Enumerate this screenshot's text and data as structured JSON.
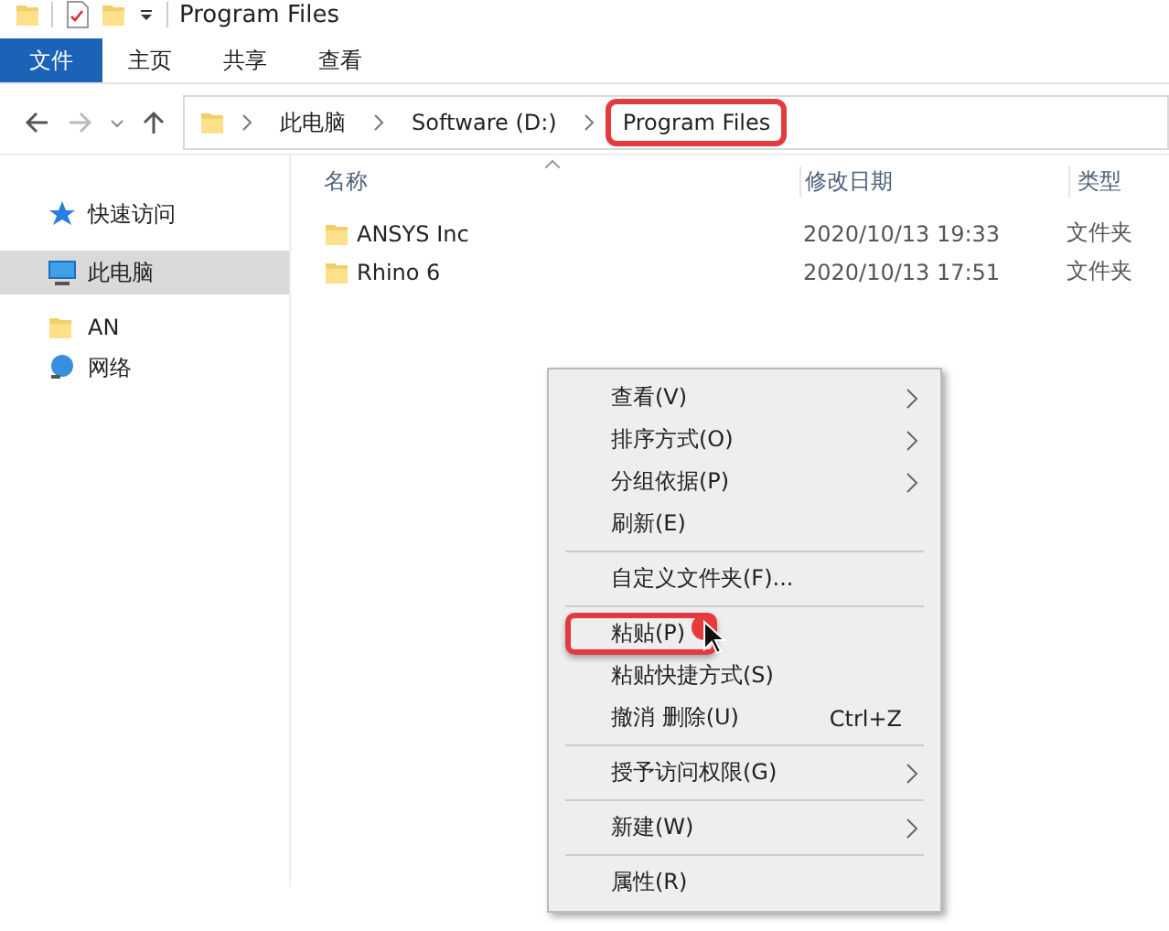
{
  "window": {
    "title": "Program Files"
  },
  "ribbon_tabs": [
    {
      "label": "文件",
      "selected": true
    },
    {
      "label": "主页",
      "selected": false
    },
    {
      "label": "共享",
      "selected": false
    },
    {
      "label": "查看",
      "selected": false
    }
  ],
  "breadcrumb": [
    {
      "label": "此电脑",
      "highlighted": false
    },
    {
      "label": "Software (D:)",
      "highlighted": false
    },
    {
      "label": "Program Files",
      "highlighted": true
    }
  ],
  "sidebar": {
    "items": [
      {
        "label": "快速访问",
        "kind": "star",
        "selected": false
      },
      {
        "label": "此电脑",
        "kind": "pc",
        "selected": true
      },
      {
        "label": "AN",
        "kind": "folder",
        "selected": false
      },
      {
        "label": "网络",
        "kind": "network",
        "selected": false
      }
    ]
  },
  "table": {
    "columns": [
      "名称",
      "修改日期",
      "类型"
    ],
    "rows": [
      [
        "ANSYS Inc",
        "2020/10/13 19:33",
        "文件夹"
      ],
      [
        "Rhino 6",
        "2020/10/13 17:51",
        "文件夹"
      ]
    ]
  },
  "context_menu": {
    "items": [
      {
        "label": "查看(V)",
        "submenu": true,
        "highlighted": false
      },
      {
        "label": "排序方式(O)",
        "submenu": true,
        "highlighted": false
      },
      {
        "label": "分组依据(P)",
        "submenu": true,
        "highlighted": false
      },
      {
        "label": "刷新(E)",
        "submenu": false,
        "highlighted": false,
        "separator_after": true
      },
      {
        "label": "自定义文件夹(F)...",
        "submenu": false,
        "highlighted": false,
        "separator_after": true
      },
      {
        "label": "粘贴(P)",
        "submenu": false,
        "highlighted": true
      },
      {
        "label": "粘贴快捷方式(S)",
        "submenu": false,
        "highlighted": false
      },
      {
        "label": "撤消 删除(U)",
        "shortcut": "Ctrl+Z",
        "submenu": false,
        "highlighted": false,
        "separator_after": true
      },
      {
        "label": "授予访问权限(G)",
        "submenu": true,
        "highlighted": false,
        "separator_after": true
      },
      {
        "label": "新建(W)",
        "submenu": true,
        "highlighted": false,
        "separator_after": true
      },
      {
        "label": "属性(R)",
        "submenu": false,
        "highlighted": false
      }
    ]
  }
}
